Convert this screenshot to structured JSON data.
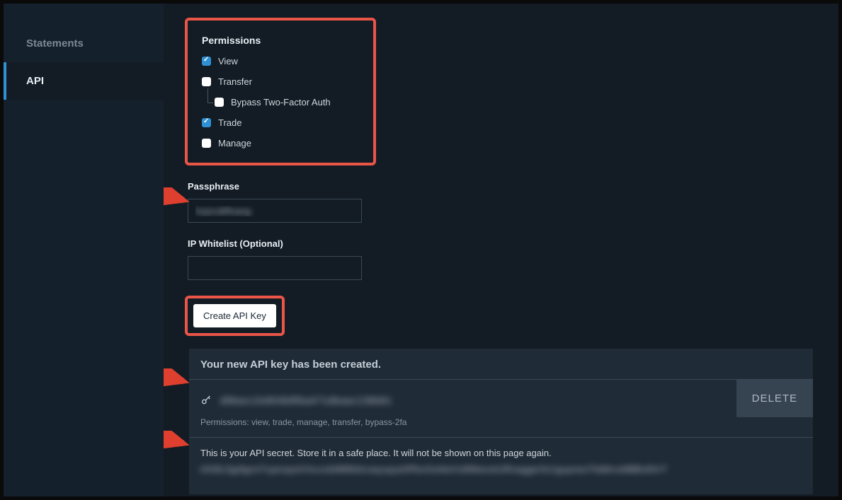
{
  "sidebar": {
    "items": [
      {
        "label": "Statements"
      },
      {
        "label": "API"
      }
    ]
  },
  "permissions": {
    "title": "Permissions",
    "options": {
      "view": "View",
      "transfer": "Transfer",
      "bypass2fa": "Bypass Two-Factor Auth",
      "trade": "Trade",
      "manage": "Manage"
    }
  },
  "passphrase": {
    "label": "Passphrase",
    "value": "hxjsruMfoang"
  },
  "ipwhitelist": {
    "label": "IP Whitelist (Optional)",
    "value": ""
  },
  "create_button": "Create API Key",
  "result": {
    "heading": "Your new API key has been created.",
    "api_key_masked": "d9bacc2e804b8fba471dbaac138b81",
    "permissions_line": "Permissions: view, trade, manage, transfer, bypass-2fa",
    "delete_label": "DELETE",
    "secret_msg": "This is your API secret. Store it in a safe place. It will not be shown on this page again.",
    "secret_masked": "tXh8L0gdigxrt7cperqueVIncxvb9Mlkblcoayupye0PbvOoAteVs8WwcetURnagger0z1gupnesTtddtrce8BBv8XrT"
  }
}
